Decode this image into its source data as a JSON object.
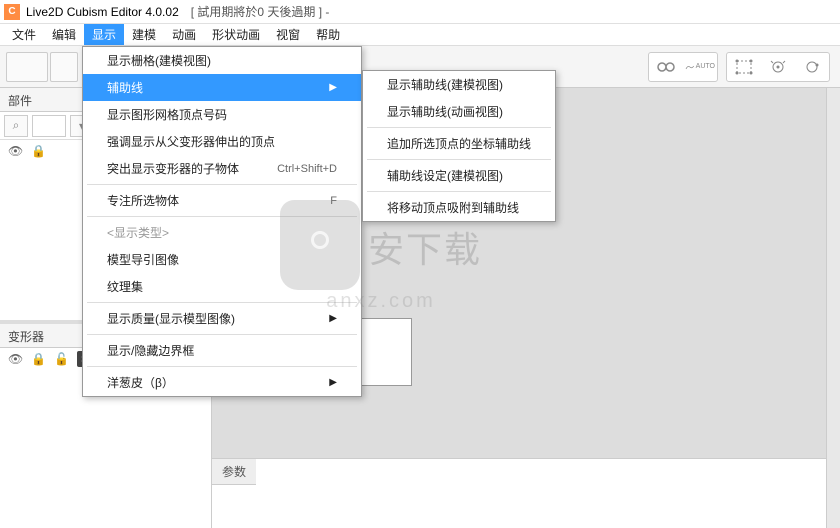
{
  "titlebar": {
    "app": "Live2D Cubism Editor 4.0.02",
    "trial": "[ 試用期將於0 天後過期 ]  -"
  },
  "menubar": [
    "文件",
    "编辑",
    "显示",
    "建模",
    "动画",
    "形状动画",
    "视窗",
    "帮助"
  ],
  "active_menu_index": 2,
  "dropdown": {
    "items": [
      {
        "label": "显示栅格(建模视图)",
        "sep": false
      },
      {
        "label": "辅助线",
        "arrow": true,
        "highlighted": true
      },
      {
        "label": "显示图形网格顶点号码"
      },
      {
        "label": "强调显示从父变形器伸出的顶点"
      },
      {
        "label": "突出显示变形器的子物体",
        "shortcut": "Ctrl+Shift+D",
        "sep_after": true
      },
      {
        "label": "专注所选物体",
        "shortcut": "F",
        "sep_after": true
      },
      {
        "label": "<显示类型>",
        "disabled": true
      },
      {
        "label": "模型导引图像"
      },
      {
        "label": "纹理集",
        "sep_after": true
      },
      {
        "label": "显示质量(显示模型图像)",
        "arrow": true,
        "sep_after": true
      },
      {
        "label": "显示/隐藏边界框",
        "sep_after": true
      },
      {
        "label": "洋葱皮（β）",
        "arrow": true
      }
    ]
  },
  "submenu": {
    "items": [
      {
        "label": "显示辅助线(建模视图)"
      },
      {
        "label": "显示辅助线(动画视图)",
        "sep_after": true
      },
      {
        "label": "追加所选顶点的坐标辅助线",
        "sep_after": true
      },
      {
        "label": "辅助线设定(建模视图)",
        "sep_after": true
      },
      {
        "label": "将移动顶点吸附到辅助线"
      }
    ]
  },
  "panels": {
    "parts": "部件",
    "deformer": "变形器",
    "params": "参数"
  },
  "watermark": {
    "big": "安下载",
    "small": "anxz.com"
  },
  "toolbar_auto": "AUTO"
}
